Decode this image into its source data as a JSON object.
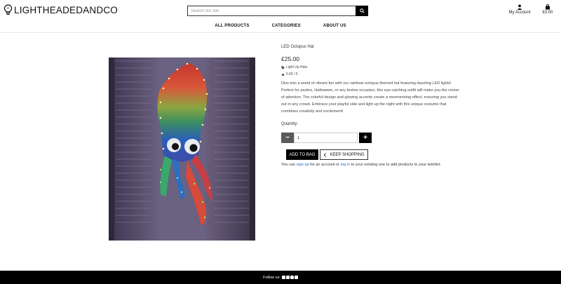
{
  "brand": {
    "name": "LIGHTHEADEDANDCO",
    "logo_icon": "lightbulb-icon"
  },
  "search": {
    "placeholder": "Search our site",
    "icon": "search-icon"
  },
  "header": {
    "account_label": "My Account",
    "account_icon": "user-icon",
    "bag_total": "£0.00",
    "bag_icon": "shopping-bag-icon"
  },
  "nav": {
    "items": [
      {
        "label": "ALL PRODUCTS"
      },
      {
        "label": "CATEGORIES"
      },
      {
        "label": "ABOUT US"
      }
    ]
  },
  "product": {
    "name": "LED Octopus Hat",
    "price": "£25.00",
    "category": "Light Up Hats",
    "category_icon": "tag-icon",
    "rating": "5.00 / 5",
    "rating_icon": "star-icon",
    "description": "Dive into a world of vibrant fun with our rainbow octopus-themed hat featuring dazzling LED lights! Perfect for parties, Halloween, or any festive occasion, this eye-catching outfit will make you the center of attention. The colorful design and glowing accents create a mesmerizing effect, ensuring you stand out in any crowd. Embrace your playful side and light up the night with this unique costume that combines creativity and excitement!"
  },
  "quantity": {
    "label": "Quantity:",
    "value": "1",
    "minus": "−",
    "plus": "+"
  },
  "actions": {
    "add_to_bag": "ADD TO BAG",
    "keep_shopping": "KEEP SHOPPING"
  },
  "signin_note": {
    "prefix": "You can ",
    "sign_up": "sign up",
    "middle": " for an account or ",
    "log_in": "log in",
    "suffix": " to your existing one to add products to your wishlist."
  },
  "footer": {
    "follow_label": "Follow us:",
    "social_icons": [
      "facebook-icon",
      "twitter-icon",
      "instagram-icon",
      "youtube-icon"
    ]
  }
}
